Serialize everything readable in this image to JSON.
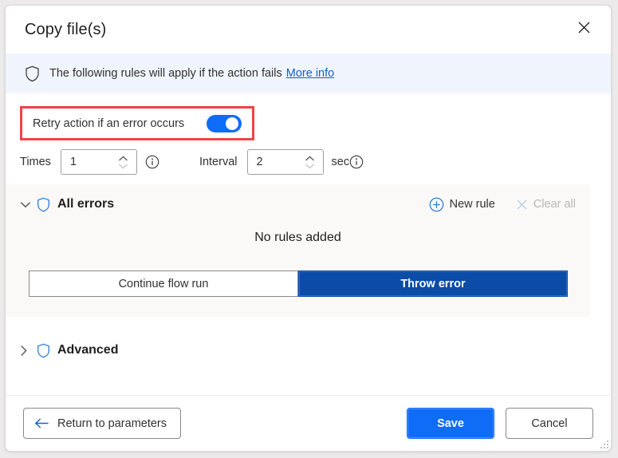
{
  "window": {
    "title": "Copy file(s)",
    "close_icon": "close-icon",
    "resize_grip": "resize-grip"
  },
  "banner": {
    "shield_icon": "shield-icon",
    "text": "The following rules will apply if the action fails",
    "link_label": "More info"
  },
  "retry": {
    "label": "Retry action if an error occurs",
    "toggle_state": "on",
    "highlight_color": "#ef4444"
  },
  "numeric": {
    "times_label": "Times",
    "times_value": "1",
    "times_info_icon": "info-icon",
    "interval_label": "Interval",
    "interval_value": "2",
    "interval_unit": "sec",
    "interval_info_icon": "info-icon",
    "spinner_up_icon": "chevron-up-icon",
    "spinner_down_icon": "chevron-down-icon"
  },
  "all_errors": {
    "expand_icon": "chevron-down-icon",
    "shield_icon": "shield-icon",
    "title": "All errors",
    "new_rule_label": "New rule",
    "new_rule_icon": "plus-circle-icon",
    "clear_all_label": "Clear all",
    "clear_all_icon": "close-icon",
    "clear_all_disabled": true,
    "empty_text": "No rules added",
    "segmented": {
      "options": [
        "Continue flow run",
        "Throw error"
      ],
      "selected": "Throw error",
      "selected_color": "#0b4ca8"
    }
  },
  "advanced": {
    "expand_icon": "chevron-right-icon",
    "shield_icon": "shield-icon",
    "title": "Advanced"
  },
  "footer": {
    "return_label": "Return to parameters",
    "return_icon": "arrow-left-icon",
    "save_label": "Save",
    "cancel_label": "Cancel",
    "primary_color": "#0f6cf7"
  }
}
